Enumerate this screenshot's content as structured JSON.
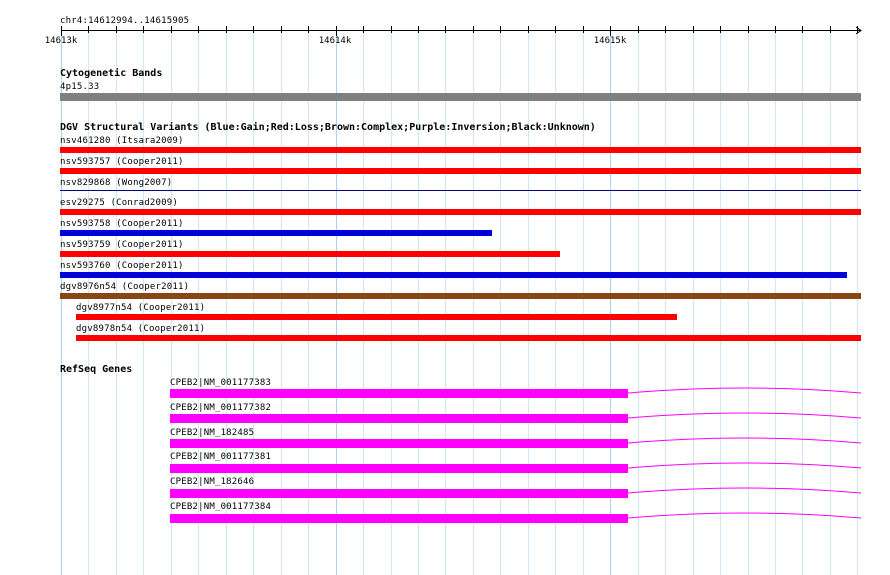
{
  "location": "chr4:14612994..14615905",
  "ruler": {
    "tick_labels": [
      "14613k",
      "14614k",
      "14615k"
    ]
  },
  "tracks": {
    "cyto": {
      "title": "Cytogenetic Bands",
      "band_label": "4p15.33",
      "band_color": "#808080"
    },
    "dgv": {
      "title": "DGV Structural Variants (Blue:Gain;Red:Loss;Brown:Complex;Purple:Inversion;Black:Unknown)",
      "features": [
        {
          "label": "nsv461280 (Itsara2009)",
          "color": "#ff0000",
          "thin": false
        },
        {
          "label": "nsv593757 (Cooper2011)",
          "color": "#ff0000",
          "thin": false
        },
        {
          "label": "nsv829868 (Wong2007)",
          "color": "#00008b",
          "thin": true
        },
        {
          "label": "esv29275 (Conrad2009)",
          "color": "#ff0000",
          "thin": false
        },
        {
          "label": "nsv593758 (Cooper2011)",
          "color": "#0000dd",
          "thin": false
        },
        {
          "label": "nsv593759 (Cooper2011)",
          "color": "#ff0000",
          "thin": false
        },
        {
          "label": "nsv593760 (Cooper2011)",
          "color": "#0000dd",
          "thin": false
        },
        {
          "label": "dgv8976n54 (Cooper2011)",
          "color": "#8b4513",
          "thin": false
        },
        {
          "label": "dgv8977n54 (Cooper2011)",
          "color": "#ff0000",
          "thin": false
        },
        {
          "label": "dgv8978n54 (Cooper2011)",
          "color": "#ff0000",
          "thin": false
        }
      ]
    },
    "refseq": {
      "title": "RefSeq Genes",
      "color": "#ff00ff",
      "genes": [
        {
          "label": "CPEB2|NM_001177383"
        },
        {
          "label": "CPEB2|NM_001177382"
        },
        {
          "label": "CPEB2|NM_182485"
        },
        {
          "label": "CPEB2|NM_001177381"
        },
        {
          "label": "CPEB2|NM_182646"
        },
        {
          "label": "CPEB2|NM_001177384"
        }
      ]
    }
  }
}
